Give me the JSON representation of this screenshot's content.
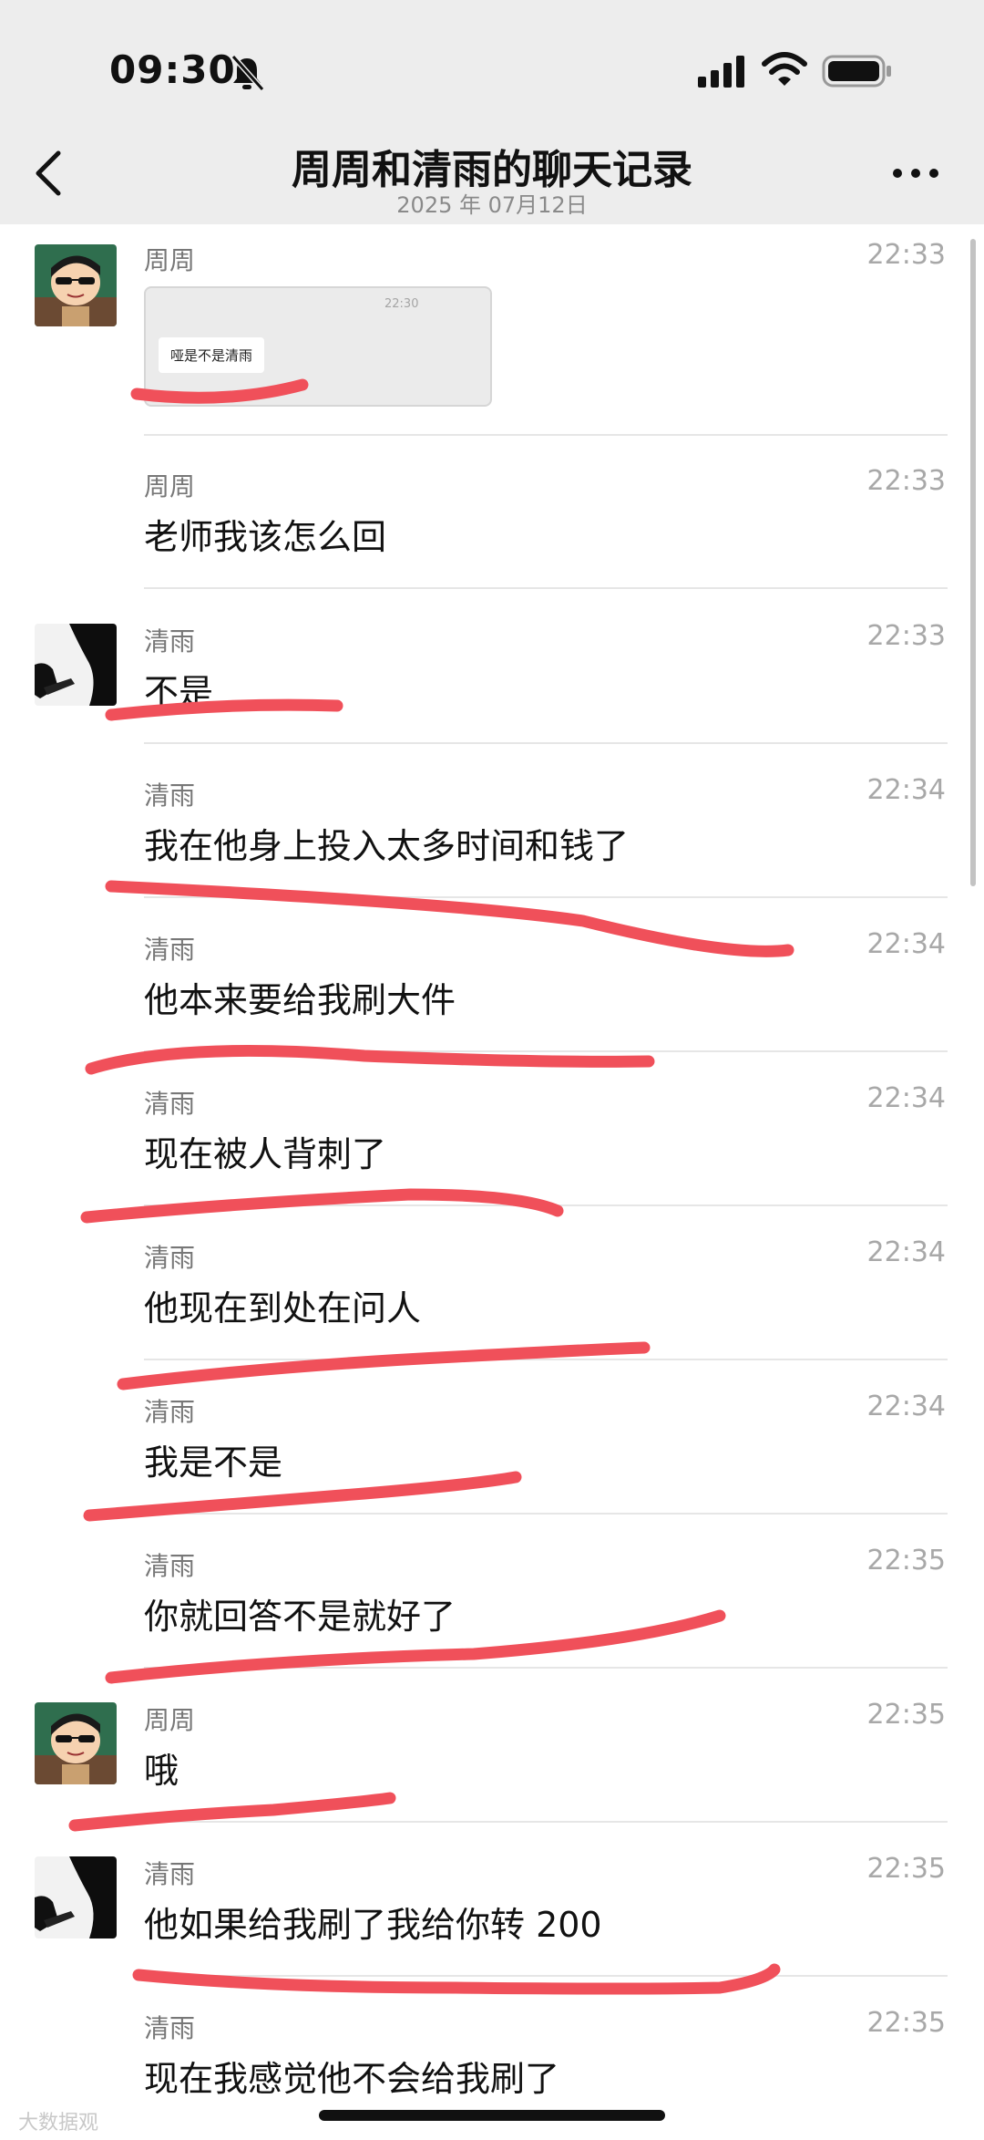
{
  "status": {
    "time": "09:30"
  },
  "nav": {
    "title": "周周和清雨的聊天记录",
    "date": "2025 年 07月12日"
  },
  "image_preview": {
    "time": "22:30",
    "text": "哑是不是清雨"
  },
  "messages": [
    {
      "sender": "周周",
      "time": "22:33",
      "text": ""
    },
    {
      "sender": "周周",
      "time": "22:33",
      "text": "老师我该怎么回"
    },
    {
      "sender": "清雨",
      "time": "22:33",
      "text": "不是"
    },
    {
      "sender": "清雨",
      "time": "22:34",
      "text": "我在他身上投入太多时间和钱了"
    },
    {
      "sender": "清雨",
      "time": "22:34",
      "text": "他本来要给我刷大件"
    },
    {
      "sender": "清雨",
      "time": "22:34",
      "text": "现在被人背刺了"
    },
    {
      "sender": "清雨",
      "time": "22:34",
      "text": "他现在到处在问人"
    },
    {
      "sender": "清雨",
      "time": "22:34",
      "text": "我是不是"
    },
    {
      "sender": "清雨",
      "time": "22:35",
      "text": "你就回答不是就好了"
    },
    {
      "sender": "周周",
      "time": "22:35",
      "text": "哦"
    },
    {
      "sender": "清雨",
      "time": "22:35",
      "text": "他如果给我刷了我给你转 200"
    },
    {
      "sender": "清雨",
      "time": "22:35",
      "text": "现在我感觉他不会给我刷了"
    }
  ],
  "watermark": "大数据观",
  "colors": {
    "header_bg": "#ededed",
    "underline": "#f0505a",
    "time": "#a8a8a8"
  }
}
